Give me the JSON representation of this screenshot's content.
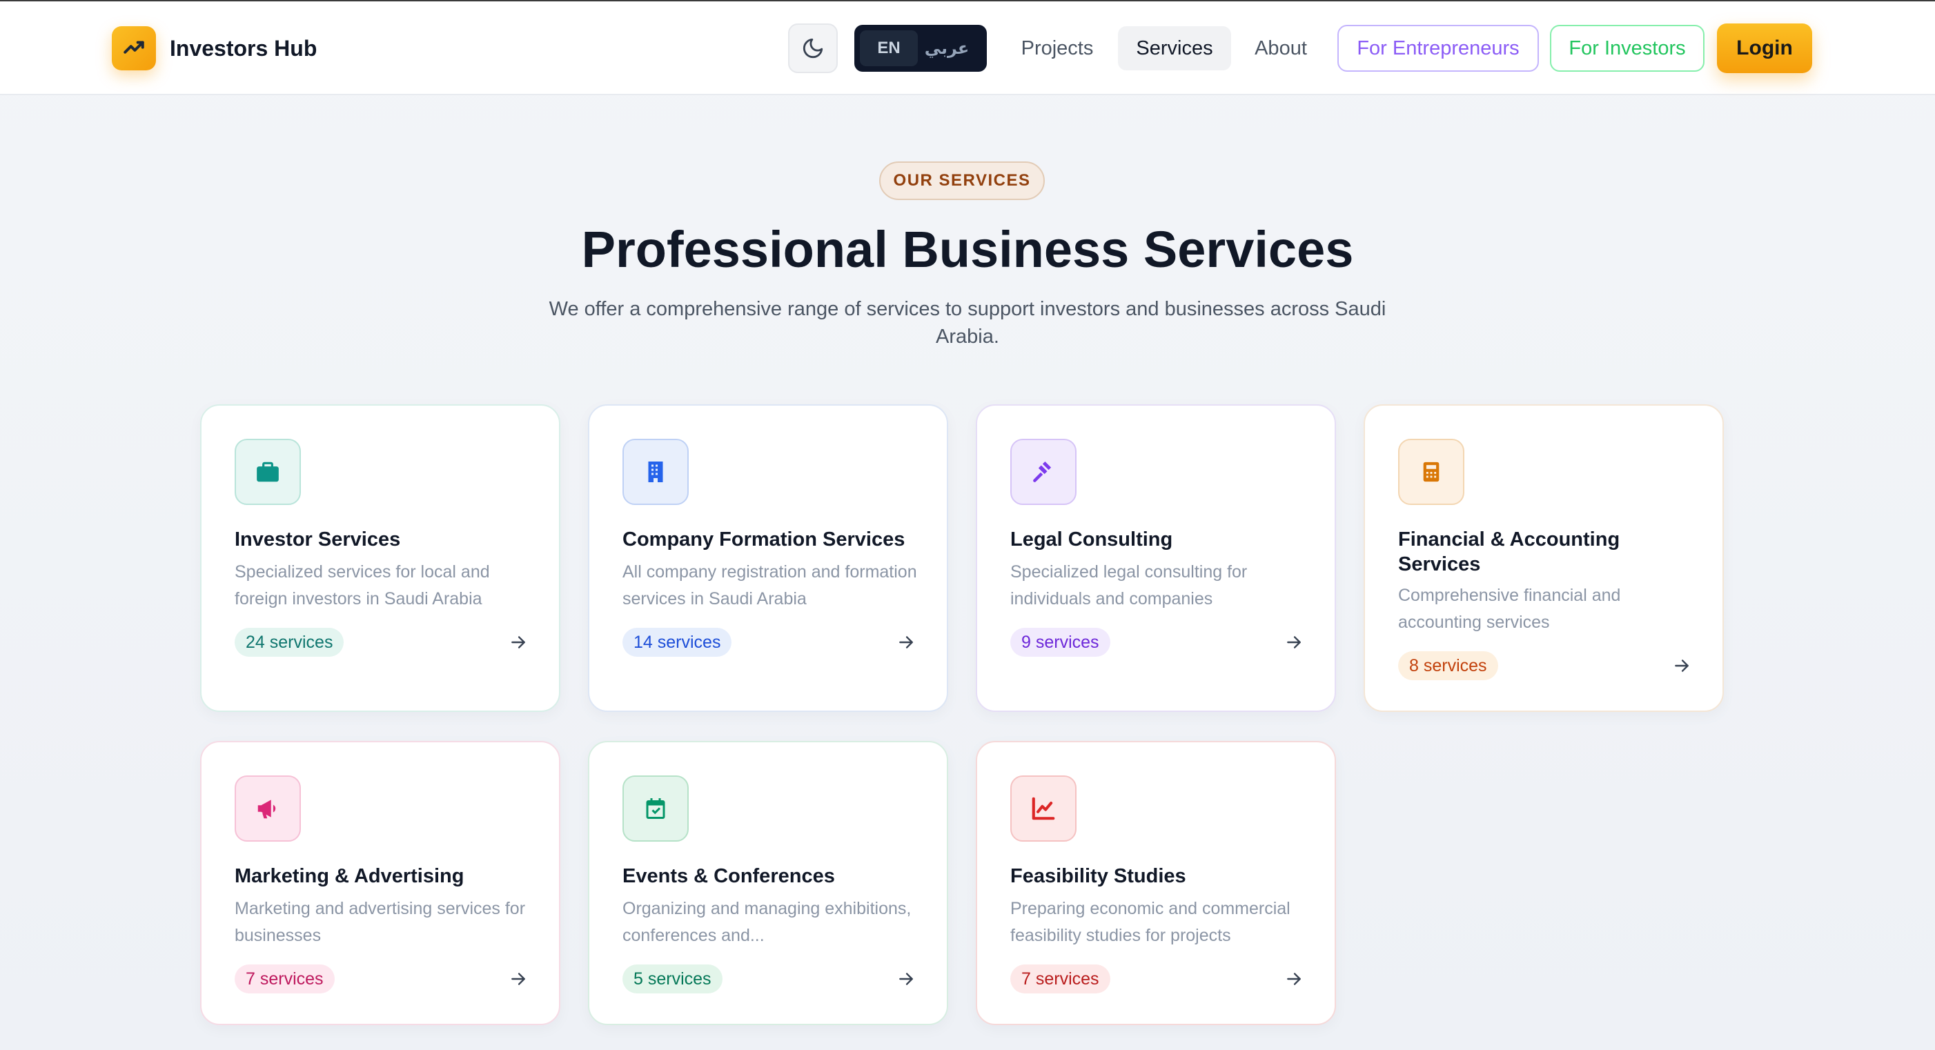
{
  "header": {
    "brand_name": "Investors Hub",
    "lang_en": "EN",
    "lang_ar": "عربي",
    "nav": {
      "projects": "Projects",
      "services": "Services",
      "about": "About"
    },
    "for_entrepreneurs": "For Entrepreneurs",
    "for_investors": "For Investors",
    "login": "Login"
  },
  "hero": {
    "eyebrow": "OUR SERVICES",
    "title": "Professional Business Services",
    "subtitle": "We offer a comprehensive range of services to support investors and businesses across Saudi Arabia."
  },
  "colors": {
    "accent": "#f59e0b",
    "investor": "#0d9488",
    "company": "#2563eb",
    "legal": "#7c3aed",
    "financial": "#d97706",
    "marketing": "#db2777",
    "events": "#059669",
    "feasibility": "#dc2626"
  },
  "cards": [
    {
      "title": "Investor Services",
      "description": "Specialized services for local and foreign investors in Saudi Arabia",
      "count": "24 services",
      "icon": "briefcase-icon"
    },
    {
      "title": "Company Formation Services",
      "description": "All company registration and formation services in Saudi Arabia",
      "count": "14 services",
      "icon": "building-icon"
    },
    {
      "title": "Legal Consulting",
      "description": "Specialized legal consulting for individuals and companies",
      "count": "9 services",
      "icon": "gavel-icon"
    },
    {
      "title": "Financial & Accounting Services",
      "description": "Comprehensive financial and accounting services",
      "count": "8 services",
      "icon": "calculator-icon"
    },
    {
      "title": "Marketing & Advertising",
      "description": "Marketing and advertising services for businesses",
      "count": "7 services",
      "icon": "megaphone-icon"
    },
    {
      "title": "Events & Conferences",
      "description": "Organizing and managing exhibitions, conferences and...",
      "count": "5 services",
      "icon": "calendar-check-icon"
    },
    {
      "title": "Feasibility Studies",
      "description": "Preparing economic and commercial feasibility studies for projects",
      "count": "7 services",
      "icon": "line-chart-icon"
    }
  ]
}
